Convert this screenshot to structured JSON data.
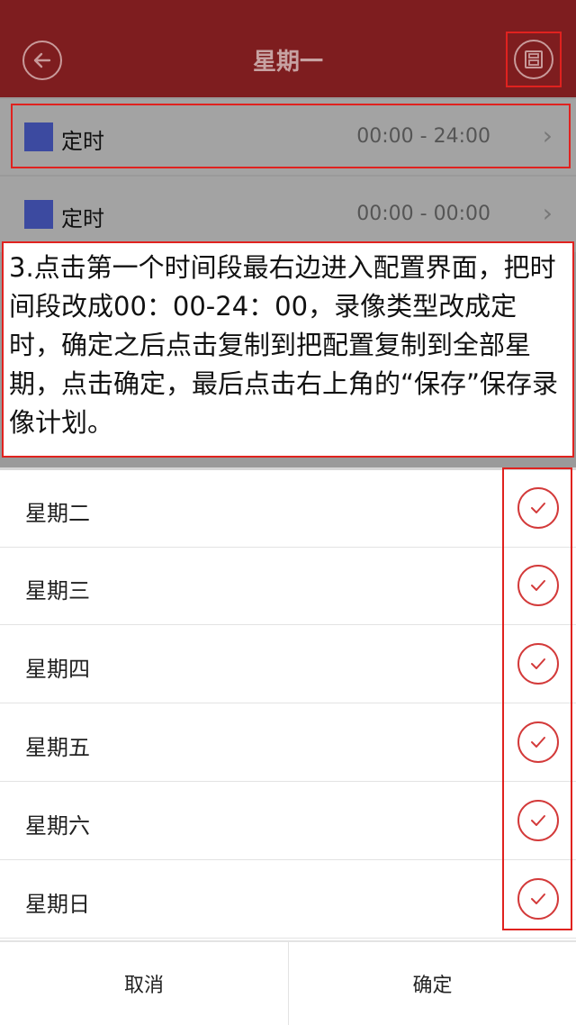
{
  "header": {
    "title": "星期一",
    "back_icon": "back-arrow-icon",
    "save_icon": "save-icon"
  },
  "time_slots": [
    {
      "type": "定时",
      "range": "00:00 - 24:00",
      "color": "#3c4aa0"
    },
    {
      "type": "定时",
      "range": "00:00 - 00:00",
      "color": "#3c4aa0"
    }
  ],
  "instruction": {
    "text": "3.点击第一个时间段最右边进入配置界面，把时间段改成00：00-24：00，录像类型改成定时，确定之后点击复制到把配置复制到全部星期，点击确定，最后点击右上角的“保存”保存录像计划。"
  },
  "days": [
    {
      "label": "星期二",
      "checked": true
    },
    {
      "label": "星期三",
      "checked": true
    },
    {
      "label": "星期四",
      "checked": true
    },
    {
      "label": "星期五",
      "checked": true
    },
    {
      "label": "星期六",
      "checked": true
    },
    {
      "label": "星期日",
      "checked": true
    }
  ],
  "footer": {
    "cancel_label": "取消",
    "confirm_label": "确定"
  },
  "colors": {
    "header_bg": "#7e1d1f",
    "annotation_red": "#e0221f",
    "check_red": "#d33a3a"
  }
}
